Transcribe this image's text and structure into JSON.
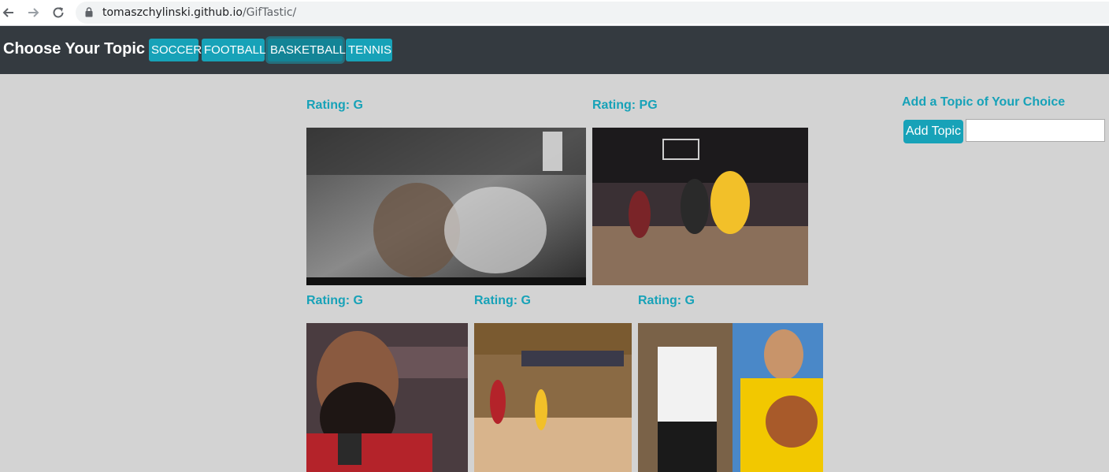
{
  "browser": {
    "url_host": "tomaszchylinski.github.io",
    "url_path": "/GifTastic/"
  },
  "header": {
    "title": "Choose Your Topic",
    "topics": [
      "SOCCER",
      "FOOTBALL",
      "BASKETBALL",
      "TENNIS"
    ],
    "active_topic": "BASKETBALL"
  },
  "gifs": [
    {
      "rating": "Rating: G"
    },
    {
      "rating": "Rating: PG"
    },
    {
      "rating": "Rating: G"
    },
    {
      "rating": "Rating: G"
    },
    {
      "rating": "Rating: G"
    }
  ],
  "add_topic": {
    "title": "Add a Topic of Your Choice",
    "button_label": "Add Topic",
    "input_value": ""
  },
  "colors": {
    "accent": "#17a2b8",
    "header_bg": "#343a40",
    "page_bg": "#d3d3d3"
  }
}
